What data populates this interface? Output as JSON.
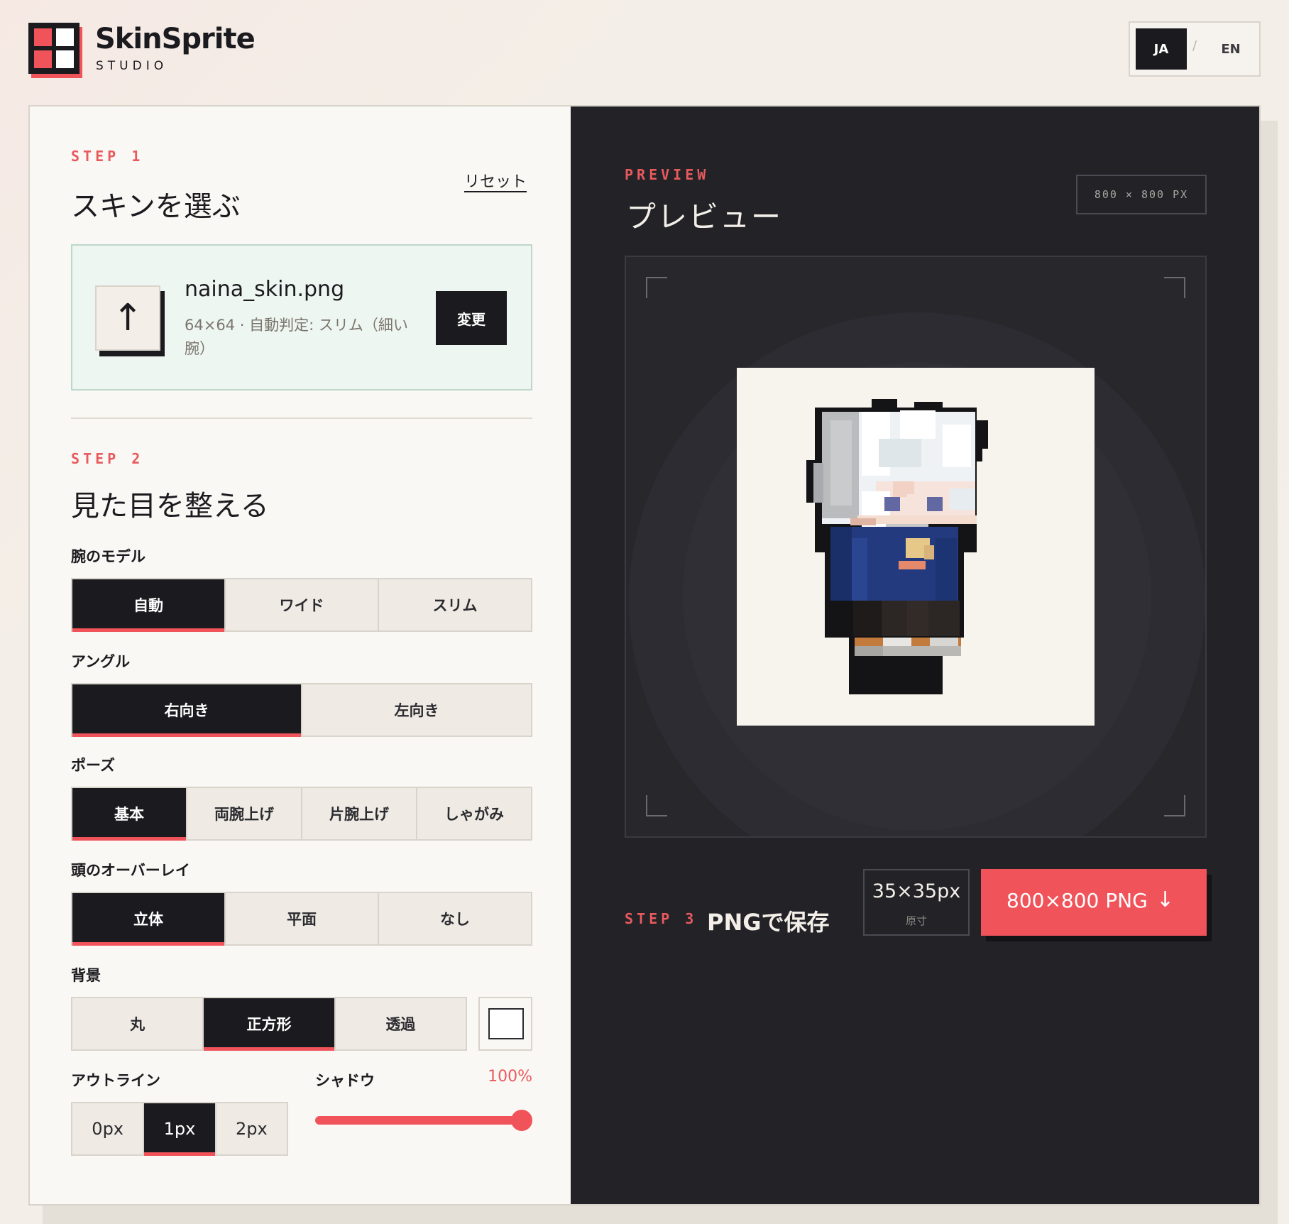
{
  "brand": {
    "name": "SkinSprite",
    "sub": "STUDIO",
    "colors": {
      "accent": "#f0545a",
      "dark": "#1b1b1f"
    }
  },
  "lang": {
    "ja": "JA",
    "sep": "/",
    "en": "EN",
    "selected": "JA"
  },
  "step1": {
    "label": "STEP 1",
    "title": "スキンを選ぶ",
    "reset": "リセット",
    "upload_icon": "upload-arrow-icon",
    "upload_glyph": "↑",
    "file_name": "naina_skin.png",
    "file_meta": "64×64 · 自動判定: スリム（細い腕）",
    "change": "変更"
  },
  "step2": {
    "label": "STEP 2",
    "title": "見た目を整える",
    "arm": {
      "label": "腕のモデル",
      "options": [
        "自動",
        "ワイド",
        "スリム"
      ],
      "selected": "自動"
    },
    "angle": {
      "label": "アングル",
      "options": [
        "右向き",
        "左向き"
      ],
      "selected": "右向き"
    },
    "pose": {
      "label": "ポーズ",
      "options": [
        "基本",
        "両腕上げ",
        "片腕上げ",
        "しゃがみ"
      ],
      "selected": "基本"
    },
    "overlay": {
      "label": "頭のオーバーレイ",
      "options": [
        "立体",
        "平面",
        "なし"
      ],
      "selected": "立体"
    },
    "background": {
      "label": "背景",
      "options": [
        "丸",
        "正方形",
        "透過"
      ],
      "selected": "正方形",
      "swatch_color": "#ffffff"
    },
    "outline": {
      "label": "アウトライン",
      "options": [
        "0px",
        "1px",
        "2px"
      ],
      "selected": "1px"
    },
    "shadow": {
      "label": "シャドウ",
      "value_text": "100%",
      "value": 1.0
    }
  },
  "preview": {
    "label": "PREVIEW",
    "title": "プレビュー",
    "size_tag": "800 × 800 PX"
  },
  "step3": {
    "label": "STEP 3",
    "title": "PNGで保存",
    "original_value": "35×35px",
    "original_label": "原寸",
    "download_label": "800×800 PNG",
    "download_icon": "↓"
  }
}
